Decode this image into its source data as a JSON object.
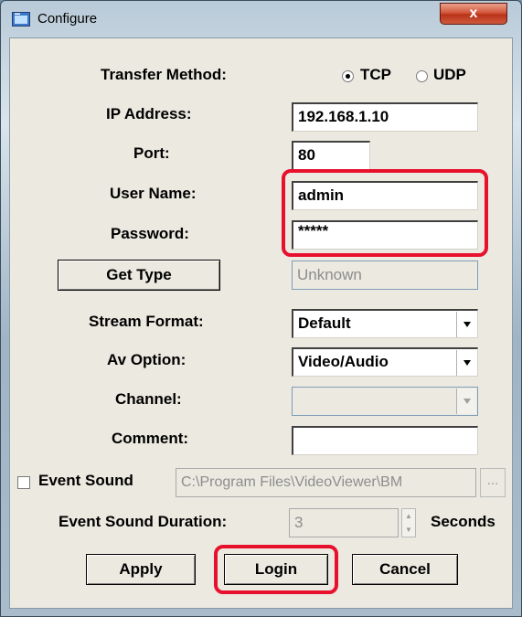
{
  "window": {
    "title": "Configure",
    "close_label": "x"
  },
  "transfer_method": {
    "label": "Transfer Method:",
    "options": [
      "TCP",
      "UDP"
    ],
    "selected": "TCP"
  },
  "ip_address": {
    "label": "IP Address:",
    "value": "192.168.1.10"
  },
  "port": {
    "label": "Port:",
    "value": "80"
  },
  "user_name": {
    "label": "User Name:",
    "value": "admin"
  },
  "password": {
    "label": "Password:",
    "value": "*****"
  },
  "get_type": {
    "button_label": "Get Type",
    "value": "Unknown"
  },
  "stream_format": {
    "label": "Stream Format:",
    "value": "Default"
  },
  "av_option": {
    "label": "Av Option:",
    "value": "Video/Audio"
  },
  "channel": {
    "label": "Channel:",
    "value": ""
  },
  "comment": {
    "label": "Comment:",
    "value": ""
  },
  "event_sound": {
    "label": "Event Sound",
    "checked": false,
    "path": "C:\\Program Files\\VideoViewer\\BM",
    "browse_label": "..."
  },
  "event_sound_duration": {
    "label": "Event Sound Duration:",
    "value": "3",
    "unit": "Seconds"
  },
  "buttons": {
    "apply": "Apply",
    "login": "Login",
    "cancel": "Cancel"
  },
  "colors": {
    "highlight": "#e8112d",
    "close_button": "#c8452a",
    "dialog_face": "#ebe9e0"
  }
}
